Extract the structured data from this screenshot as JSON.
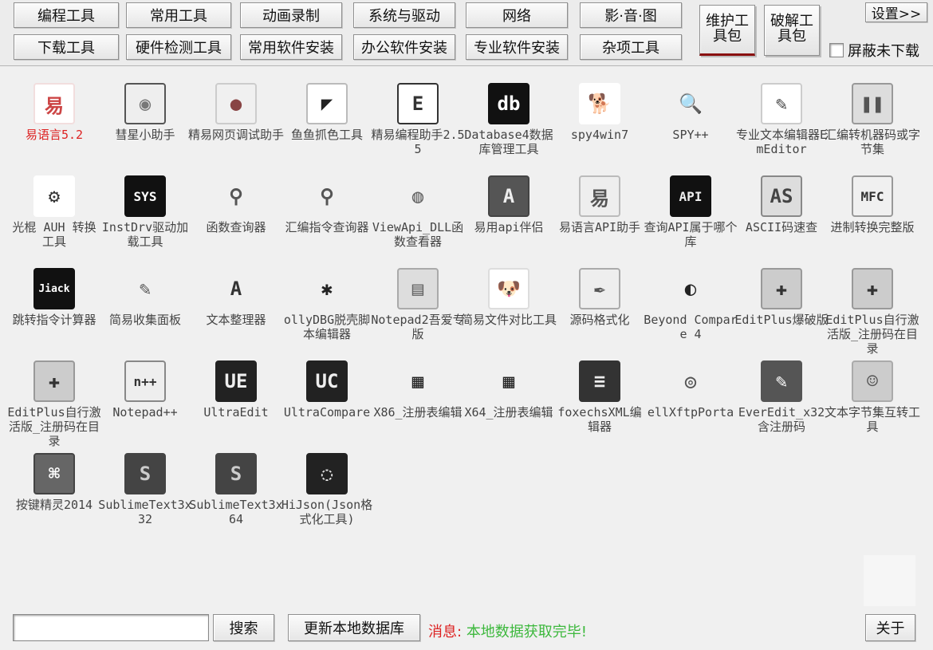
{
  "toolbar": {
    "row1": [
      "编程工具",
      "常用工具",
      "动画录制",
      "系统与驱动",
      "网络",
      "影·音·图"
    ],
    "row2": [
      "下载工具",
      "硬件检测工具",
      "常用软件安装",
      "办公软件安装",
      "专业软件安装",
      "杂项工具"
    ],
    "kit1": "维护工具包",
    "kit2": "破解工具包",
    "settings": "设置>>",
    "hide_undownloaded": "屏蔽未下载"
  },
  "items": [
    {
      "label": "易语言5.2",
      "icon": "e-language-icon",
      "highlight": true
    },
    {
      "label": "彗星小助手",
      "icon": "comet-helper-icon"
    },
    {
      "label": "精易网页调试助手",
      "icon": "web-debug-icon"
    },
    {
      "label": "鱼鱼抓色工具",
      "icon": "color-picker-icon"
    },
    {
      "label": "精易编程助手2.55",
      "icon": "jingyi-icon"
    },
    {
      "label": "Database4数据库管理工具",
      "icon": "database-icon"
    },
    {
      "label": "spy4win7",
      "icon": "spy-dog-icon"
    },
    {
      "label": "SPY++",
      "icon": "magnifier-icon"
    },
    {
      "label": "专业文本编辑器EmEditor",
      "icon": "emeditor-icon"
    },
    {
      "label": "汇编转机器码或字节集",
      "icon": "asm-convert-icon"
    },
    {
      "label": "光棍 AUH 转换工具",
      "icon": "gear-tool-icon"
    },
    {
      "label": "InstDrv驱动加载工具",
      "icon": "sys-driver-icon"
    },
    {
      "label": "函数查询器",
      "icon": "query-icon"
    },
    {
      "label": "汇编指令查询器",
      "icon": "query-icon"
    },
    {
      "label": "ViewApi_DLL函数查看器",
      "icon": "blender-icon"
    },
    {
      "label": "易用api伴侣",
      "icon": "api-companion-icon"
    },
    {
      "label": "易语言API助手",
      "icon": "e-api-icon"
    },
    {
      "label": "查询API属于哪个库",
      "icon": "api-icon"
    },
    {
      "label": "ASCII码速查",
      "icon": "ascii-icon"
    },
    {
      "label": "进制转换完整版",
      "icon": "mfc-blocks-icon"
    },
    {
      "label": "跳转指令计算器",
      "icon": "jiack-icon"
    },
    {
      "label": "简易收集面板",
      "icon": "pencil-note-icon"
    },
    {
      "label": "文本整理器",
      "icon": "app-store-icon"
    },
    {
      "label": "ollyDBG脱壳脚本编辑器",
      "icon": "spider-icon"
    },
    {
      "label": "Notepad2吾爱专版",
      "icon": "notepad-icon"
    },
    {
      "label": "简易文件对比工具",
      "icon": "dog-icon"
    },
    {
      "label": "源码格式化",
      "icon": "feather-icon"
    },
    {
      "label": "Beyond Compare 4",
      "icon": "beyond-compare-icon"
    },
    {
      "label": "EditPlus爆破版",
      "icon": "editplus-icon"
    },
    {
      "label": "EditPlus自行激活版_注册码在目录",
      "icon": "editplus-icon"
    },
    {
      "label": "EditPlus自行激活版_注册码在目录",
      "icon": "editplus-icon"
    },
    {
      "label": "Notepad++",
      "icon": "notepadpp-icon"
    },
    {
      "label": "UltraEdit",
      "icon": "ultraedit-icon"
    },
    {
      "label": "UltraCompare",
      "icon": "ultracompare-icon"
    },
    {
      "label": "X86_注册表编辑",
      "icon": "registry-cubes-icon"
    },
    {
      "label": "X64_注册表编辑",
      "icon": "registry-cubes-icon"
    },
    {
      "label": "foxechsXML编辑器",
      "icon": "xml-editor-icon"
    },
    {
      "label": "ellXftpPorta",
      "icon": "xftp-icon"
    },
    {
      "label": "EverEdit_x32含注册码",
      "icon": "everedit-icon"
    },
    {
      "label": "文本字节集互转工具",
      "icon": "anime-avatar-icon"
    },
    {
      "label": "按键精灵2014",
      "icon": "key-wizard-icon"
    },
    {
      "label": "SublimeText3x32",
      "icon": "sublime-icon"
    },
    {
      "label": "SublimeText3x64",
      "icon": "sublime-icon"
    },
    {
      "label": "HiJson(Json格式化工具)",
      "icon": "hijson-icon"
    }
  ],
  "bottom": {
    "search_value": "",
    "search_button": "搜索",
    "update_button": "更新本地数据库",
    "message_label": "消息:",
    "message_text": "本地数据获取完毕!",
    "about_button": "关于"
  },
  "colors": {
    "highlight": "#d22222",
    "message_ok": "#3db83d",
    "background": "#f0f0f0"
  }
}
